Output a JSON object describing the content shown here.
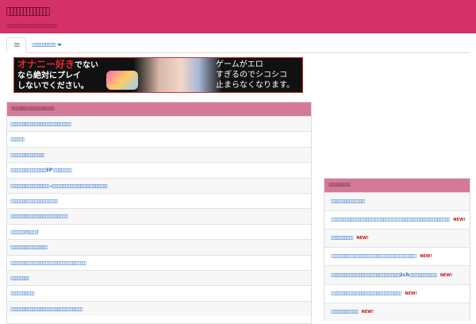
{
  "site": {
    "title": "▯▯▯▯▯▯▯▯▯▯▯▯▯",
    "subtitle": "▯▯▯▯▯▯▯▯▯▯▯▯▯▯▯▯▯▯▯▯▯▯▯▯▯▯▯▯▯▯"
  },
  "nav": {
    "home_tab": "▯▯▯",
    "dropdown": "▯▯▯▯▯▯▯▯▯▯▯▯▯▯"
  },
  "banner": {
    "left_hot": "オナニー好き",
    "left_1": "でない",
    "left_2": "なら絶対にプレイ",
    "left_3": "しないでください。",
    "right_1": "ゲームがエロ",
    "right_2": "すぎるのでシコシコ",
    "right_3": "止まらなくなります。"
  },
  "left_panel": {
    "header": "▯▯▯▯▯▯▯▯▯▯▯▯▯▯▯▯▯▯▯▯▯▯▯▯▯▯▯▯",
    "items": [
      "▯▯▯▯▯▯▯▯▯▯▯▯▯▯▯▯▯▯▯▯▯▯▯▯▯▯▯▯▯▯▯▯▯▯▯▯",
      "▯▯▯▯▯▯▯▯",
      "▯▯▯▯▯▯▯▯▯▯▯▯▯▯▯▯▯▯▯▯",
      "▯▯▯▯▯▯▯▯▯▯▯▯▯▯▯▯▯▯▯▯▯3P▯▯▯▯▯▯▯▯▯▯▯",
      "▯▯▯▯▯▯▯▯▯▯▯▯▯▯▯▯▯▯▯▯▯▯▯→▯▯▯▯▯▯▯▯▯▯▯▯▯▯▯▯▯▯▯▯▯▯▯▯▯▯▯▯▯▯▯▯▯",
      "▯▯▯▯▯▯▯▯▯▯▯▯▯▯▯▯▯▯▯▯▯▯▯▯▯▯▯▯",
      "▯▯▯▯▯▯▯▯▯▯▯▯▯▯▯▯▯▯▯▯▯▯▯▯▯▯▯▯▯▯▯▯▯▯",
      "▯▯▯▯▯▯▯▯▯ (▯▯▯▯▯▯)",
      "▯▯▯▯▯▯▯▯▯▯▯▯▯▯▯▯▯▯▯▯▯▯",
      "▯▯▯▯▯▯▯▯▯▯▯▯▯▯▯▯▯▯▯▯▯▯▯▯▯▯▯▯▯▯▯▯▯▯▯▯▯▯▯▯▯▯▯▯▯",
      "▯▯▯▯▯▯▯▯▯▯▯",
      "▯▯▯▯▯▯▯▯▯▯▯▯▯▯",
      "▯▯▯▯▯▯▯▯▯▯▯▯▯▯▯▯▯▯▯▯▯▯▯▯▯▯▯▯▯▯▯▯▯▯▯▯▯▯▯▯▯▯▯"
    ]
  },
  "right_panel": {
    "header": "▯▯▯▯▯▯▯▯▯▯▯▯▯▯",
    "new_label": "NEW!",
    "items": [
      {
        "text": "▯▯▯▯▯▯▯▯▯▯▯▯▯▯▯▯▯▯▯▯",
        "new": false
      },
      {
        "text": "▯▯▯▯ ▯▯▯▯▯▯▯▯▯▯▯▯▯▯▯▯▯▯▯▯▯▯▯▯▯▯▯▯▯▯▯▯▯▯▯▯ ▯▯▯▯▯▯▯▯▯▯▯▯▯▯▯▯▯▯▯▯▯▯▯▯▯▯▯▯▯ ▯",
        "new": true
      },
      {
        "text": "▯▯▯▯▯▯▯▯▯▯▯▯▯",
        "new": true
      },
      {
        "text": "▯▯▯▯▯▯▯▯▯▯▯▯▯▯▯▯▯▯▯▯▯▯▯▯▯▯▯▯▯▯▯▯▯▯▯▯▯▯▯▯▯▯▯▯▯▯▯▯▯▯▯",
        "new": true
      },
      {
        "text": "▯▯▯▯▯▯▯▯▯▯▯▯▯▯▯▯▯▯▯▯▯▯▯▯▯▯▯▯▯▯▯▯▯▯▯▯▯▯▯▯▯2ch▯▯▯▯▯▯▯▯▯▯▯▯▯▯▯▯",
        "new": true
      },
      {
        "text": "▯▯▯▯▯▯▯▯▯▯▯▯▯▯▯▯▯▯▯▯▯▯▯▯▯▯▯▯▯▯▯▯▯▯▯▯▯▯▯▯▯▯",
        "new": true
      },
      {
        "text": "▯▯▯▯▯▯▯▯▯▯▯▯▯▯▯▯",
        "new": true
      }
    ]
  }
}
